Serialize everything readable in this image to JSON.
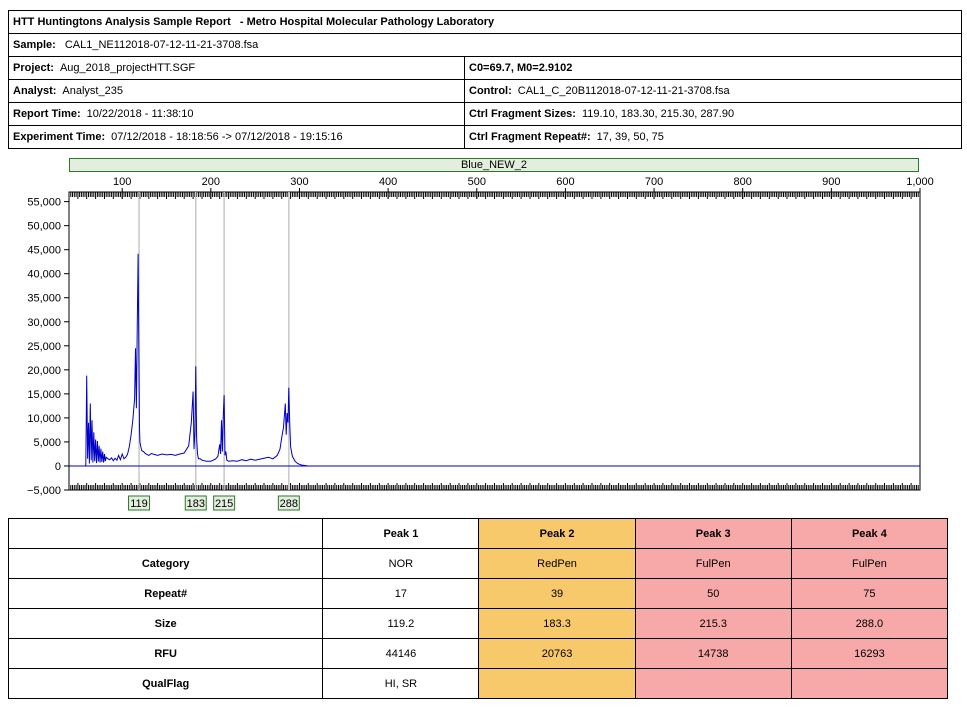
{
  "report": {
    "title": "HTT Huntingtons Analysis Sample Report",
    "lab": "- Metro Hospital Molecular Pathology Laboratory",
    "sample_label": "Sample:",
    "sample": "CAL1_NE112018-07-12-11-21-3708.fsa",
    "project_label": "Project:",
    "project": "Aug_2018_projectHTT.SGF",
    "analyst_label": "Analyst:",
    "analyst": "Analyst_235",
    "report_time_label": "Report Time:",
    "report_time": "10/22/2018 - 11:38:10",
    "experiment_time_label": "Experiment Time:",
    "experiment_time": "07/12/2018 - 18:18:56 -> 07/12/2018 - 19:15:16",
    "c0m0": "C0=69.7, M0=2.9102",
    "control_label": "Control:",
    "control": "CAL1_C_20B112018-07-12-11-21-3708.fsa",
    "ctrl_sizes_label": "Ctrl Fragment Sizes:",
    "ctrl_sizes": "119.10, 183.30, 215.30, 287.90",
    "ctrl_repeat_label": "Ctrl Fragment Repeat#:",
    "ctrl_repeat": "17, 39, 50, 75"
  },
  "plot": {
    "dye_label": "Blue_NEW_2",
    "trace_color": "#0000c8",
    "top_ticks": [
      "100",
      "200",
      "300",
      "400",
      "500",
      "600",
      "700",
      "800",
      "900",
      "1,000"
    ],
    "y_ticks": [
      "55,000",
      "50,000",
      "45,000",
      "40,000",
      "35,000",
      "30,000",
      "25,000",
      "20,000",
      "15,000",
      "10,000",
      "5,000",
      "0",
      "−5,000"
    ],
    "peak_labels": [
      "119",
      "183",
      "215",
      "288"
    ]
  },
  "chart_data": {
    "type": "line",
    "title": "",
    "xlabel": "",
    "ylabel": "",
    "xlim": [
      40,
      1000
    ],
    "ylim": [
      -5000,
      57000
    ],
    "grid": false,
    "series": [
      {
        "x": [
          40,
          58,
          59,
          60,
          61,
          62,
          63,
          64,
          65,
          66,
          67,
          68,
          69,
          70,
          71,
          72,
          73,
          74,
          75,
          76,
          77,
          78,
          79,
          80,
          81,
          82,
          84,
          86,
          88,
          90,
          92,
          94,
          96,
          98,
          100,
          102,
          104,
          106,
          108,
          110,
          112,
          114,
          115,
          116,
          117,
          118,
          119,
          119.5,
          120,
          121,
          122,
          124,
          126,
          128,
          130,
          133,
          136,
          140,
          145,
          150,
          155,
          160,
          165,
          170,
          175,
          178,
          180,
          181,
          182,
          183,
          184,
          185,
          186,
          188,
          190,
          195,
          200,
          205,
          208,
          210,
          211,
          212,
          213,
          214,
          215,
          216,
          217,
          218,
          220,
          225,
          230,
          235,
          240,
          245,
          250,
          255,
          260,
          265,
          270,
          275,
          278,
          280,
          282,
          284,
          285,
          286,
          287,
          288,
          289,
          290,
          292,
          295,
          298,
          302,
          306,
          310,
          400,
          500,
          600,
          700,
          800,
          900,
          1000
        ],
        "y": [
          0,
          0,
          200,
          18800,
          1500,
          9000,
          500,
          13000,
          1200,
          9500,
          700,
          7000,
          1000,
          5500,
          600,
          5200,
          900,
          4200,
          700,
          3600,
          800,
          3000,
          700,
          2500,
          1000,
          1800,
          1500,
          1300,
          1700,
          1100,
          1600,
          1200,
          2200,
          1300,
          2500,
          1500,
          1800,
          2400,
          4000,
          6500,
          9500,
          14000,
          24500,
          12000,
          30000,
          44146,
          20000,
          8000,
          5000,
          4000,
          3200,
          3000,
          2600,
          2400,
          2200,
          2600,
          2400,
          2200,
          2500,
          2300,
          2400,
          2200,
          2500,
          2700,
          4200,
          9000,
          15500,
          3500,
          7000,
          20763,
          6000,
          2500,
          1500,
          1500,
          1200,
          1000,
          1000,
          1400,
          2000,
          4500,
          2500,
          9500,
          3000,
          10000,
          14738,
          2200,
          3000,
          1200,
          1000,
          1100,
          1000,
          1300,
          1100,
          1400,
          1200,
          1400,
          1600,
          1800,
          1500,
          2200,
          3500,
          6000,
          8000,
          13000,
          6500,
          11000,
          9000,
          16293,
          9000,
          4000,
          2000,
          1000,
          500,
          200,
          100,
          0,
          0,
          0,
          0,
          0,
          0,
          0,
          0
        ]
      }
    ],
    "markers": [
      119,
      183,
      215,
      288
    ],
    "x_ticks": [
      100,
      200,
      300,
      400,
      500,
      600,
      700,
      800,
      900,
      1000
    ],
    "y_ticks": [
      55000,
      50000,
      45000,
      40000,
      35000,
      30000,
      25000,
      20000,
      15000,
      10000,
      5000,
      0,
      -5000
    ]
  },
  "peaks": {
    "headers": [
      "Peak 1",
      "Peak 2",
      "Peak 3",
      "Peak 4"
    ],
    "row_labels": [
      "Category",
      "Repeat#",
      "Size",
      "RFU",
      "QualFlag"
    ],
    "category": [
      "NOR",
      "RedPen",
      "FulPen",
      "FulPen"
    ],
    "repeat": [
      "17",
      "39",
      "50",
      "75"
    ],
    "size": [
      "119.2",
      "183.3",
      "215.3",
      "288.0"
    ],
    "rfu": [
      "44146",
      "20763",
      "14738",
      "16293"
    ],
    "qualflag": [
      "HI, SR",
      "",
      "",
      ""
    ],
    "colors": {
      "redpen": "#f8c96a",
      "fulpen": "#f7a9a9"
    }
  }
}
